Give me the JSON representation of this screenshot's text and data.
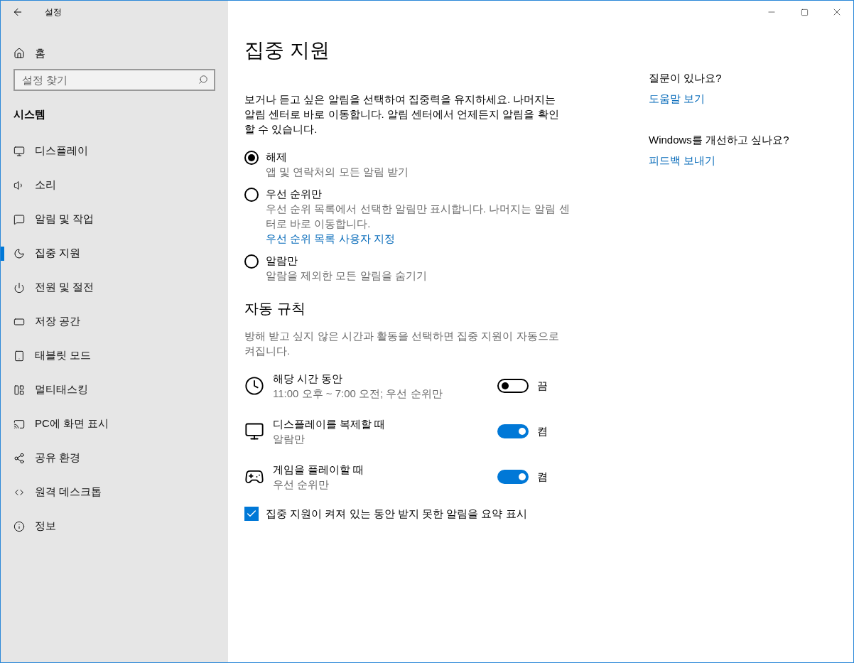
{
  "window": {
    "title": "설정"
  },
  "sidebar": {
    "home": "홈",
    "search": {
      "placeholder": "설정 찾기"
    },
    "section": "시스템",
    "items": [
      {
        "label": "디스플레이",
        "selected": false
      },
      {
        "label": "소리",
        "selected": false
      },
      {
        "label": "알림 및 작업",
        "selected": false
      },
      {
        "label": "집중 지원",
        "selected": true
      },
      {
        "label": "전원 및 절전",
        "selected": false
      },
      {
        "label": "저장 공간",
        "selected": false
      },
      {
        "label": "태블릿 모드",
        "selected": false
      },
      {
        "label": "멀티태스킹",
        "selected": false
      },
      {
        "label": "PC에 화면 표시",
        "selected": false
      },
      {
        "label": "공유 환경",
        "selected": false
      },
      {
        "label": "원격 데스크톱",
        "selected": false
      },
      {
        "label": "정보",
        "selected": false
      }
    ]
  },
  "main": {
    "title": "집중 지원",
    "description": "보거나 듣고 싶은 알림을 선택하여 집중력을 유지하세요. 나머지는 알림 센터로 바로 이동합니다. 알림 센터에서 언제든지 알림을 확인할 수 있습니다.",
    "options": [
      {
        "label": "해제",
        "detail": "앱 및 연락처의 모든 알림 받기",
        "selected": true
      },
      {
        "label": "우선 순위만",
        "detail": "우선 순위 목록에서 선택한 알림만 표시합니다. 나머지는 알림 센터로 바로 이동합니다.",
        "link": "우선 순위 목록 사용자 지정",
        "selected": false
      },
      {
        "label": "알람만",
        "detail": "알람을 제외한 모든 알림을 숨기기",
        "selected": false
      }
    ],
    "rules_heading": "자동 규칙",
    "rules_description": "방해 받고 싶지 않은 시간과 활동을 선택하면 집중 지원이 자동으로 켜집니다.",
    "rules": [
      {
        "label": "해당 시간 동안",
        "detail": "11:00 오후 ~ 7:00 오전; 우선 순위만",
        "on": false,
        "state": "끔"
      },
      {
        "label": "디스플레이를 복제할 때",
        "detail": "알람만",
        "on": true,
        "state": "켬"
      },
      {
        "label": "게임을 플레이할 때",
        "detail": "우선 순위만",
        "on": true,
        "state": "켬"
      }
    ],
    "summary": {
      "label": "집중 지원이 켜져 있는 동안 받지 못한 알림을 요약 표시",
      "checked": true
    }
  },
  "aside": [
    {
      "question": "질문이 있나요?",
      "link": "도움말 보기"
    },
    {
      "question": "Windows를 개선하고 싶나요?",
      "link": "피드백 보내기"
    }
  ]
}
